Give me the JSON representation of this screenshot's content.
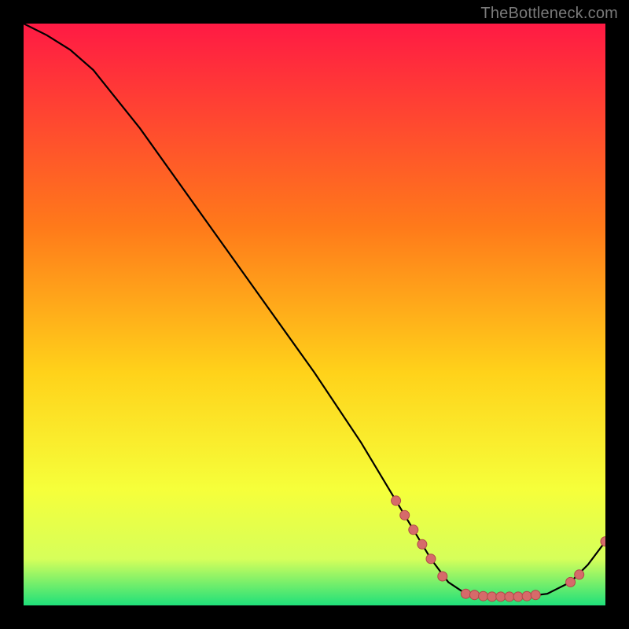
{
  "watermark": "TheBottleneck.com",
  "colors": {
    "bg_black": "#000000",
    "gradient_top": "#ff1a44",
    "gradient_mid1": "#ff7a1a",
    "gradient_mid2": "#ffd21a",
    "gradient_mid3": "#f6ff3a",
    "gradient_mid4": "#d6ff5a",
    "gradient_bottom": "#1fe07a",
    "curve": "#000000",
    "point_fill": "#d66a6a",
    "point_stroke": "#b04848"
  },
  "chart_data": {
    "type": "line",
    "title": "",
    "xlabel": "",
    "ylabel": "",
    "xlim": [
      0,
      100
    ],
    "ylim": [
      0,
      100
    ],
    "curve": [
      {
        "x": 0,
        "y": 100
      },
      {
        "x": 4,
        "y": 98
      },
      {
        "x": 8,
        "y": 95.5
      },
      {
        "x": 12,
        "y": 92
      },
      {
        "x": 20,
        "y": 82
      },
      {
        "x": 30,
        "y": 68
      },
      {
        "x": 40,
        "y": 54
      },
      {
        "x": 50,
        "y": 40
      },
      {
        "x": 58,
        "y": 28
      },
      {
        "x": 64,
        "y": 18
      },
      {
        "x": 70,
        "y": 8
      },
      {
        "x": 73,
        "y": 4
      },
      {
        "x": 76,
        "y": 2
      },
      {
        "x": 80,
        "y": 1.5
      },
      {
        "x": 86,
        "y": 1.5
      },
      {
        "x": 90,
        "y": 2
      },
      {
        "x": 94,
        "y": 4
      },
      {
        "x": 97,
        "y": 7
      },
      {
        "x": 100,
        "y": 11
      }
    ],
    "points": [
      {
        "x": 64,
        "y": 18
      },
      {
        "x": 65.5,
        "y": 15.5
      },
      {
        "x": 67,
        "y": 13
      },
      {
        "x": 68.5,
        "y": 10.5
      },
      {
        "x": 70,
        "y": 8
      },
      {
        "x": 72,
        "y": 5
      },
      {
        "x": 76,
        "y": 2
      },
      {
        "x": 77.5,
        "y": 1.8
      },
      {
        "x": 79,
        "y": 1.6
      },
      {
        "x": 80.5,
        "y": 1.5
      },
      {
        "x": 82,
        "y": 1.5
      },
      {
        "x": 83.5,
        "y": 1.5
      },
      {
        "x": 85,
        "y": 1.5
      },
      {
        "x": 86.5,
        "y": 1.6
      },
      {
        "x": 88,
        "y": 1.8
      },
      {
        "x": 94,
        "y": 4
      },
      {
        "x": 95.5,
        "y": 5.3
      },
      {
        "x": 100,
        "y": 11
      }
    ]
  }
}
